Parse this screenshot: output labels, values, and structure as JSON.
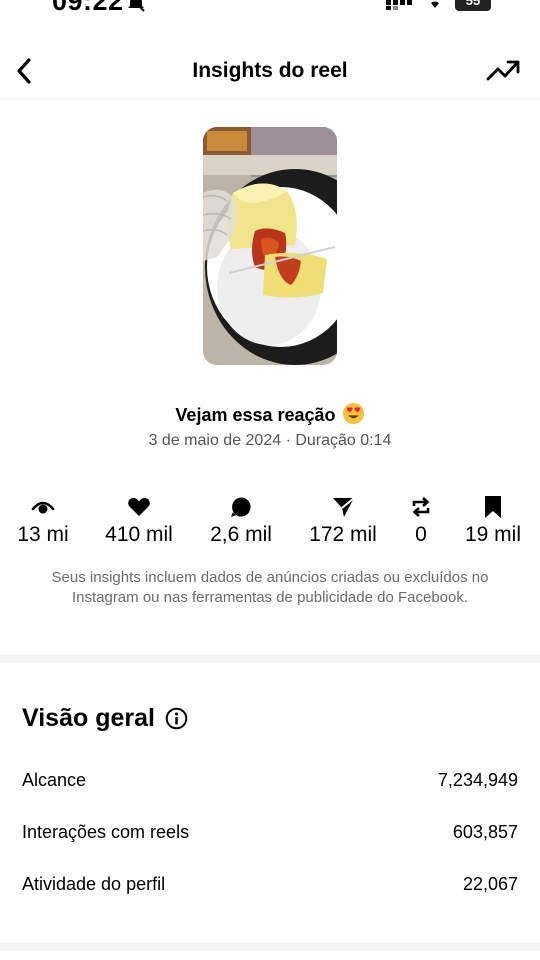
{
  "status": {
    "time": "09:22",
    "battery": "55"
  },
  "header": {
    "title": "Insights do reel"
  },
  "reel": {
    "title": "Vejam essa reação",
    "meta": "3 de maio de 2024 · Duração 0:14"
  },
  "metrics": [
    {
      "icon": "eye-icon",
      "value": "13 mi"
    },
    {
      "icon": "heart-icon",
      "value": "410 mil"
    },
    {
      "icon": "comment-icon",
      "value": "2,6 mil"
    },
    {
      "icon": "share-icon",
      "value": "172 mil"
    },
    {
      "icon": "repost-icon",
      "value": "0"
    },
    {
      "icon": "bookmark-icon",
      "value": "19 mil"
    }
  ],
  "disclaimer": "Seus insights incluem dados de anúncios criadas ou excluídos no Instagram ou nas ferramentas de publicidade do Facebook.",
  "overview": {
    "title": "Visão geral",
    "rows": [
      {
        "label": "Alcance",
        "value": "7,234,949"
      },
      {
        "label": "Interações com reels",
        "value": "603,857"
      },
      {
        "label": "Atividade do perfil",
        "value": "22,067"
      }
    ]
  }
}
